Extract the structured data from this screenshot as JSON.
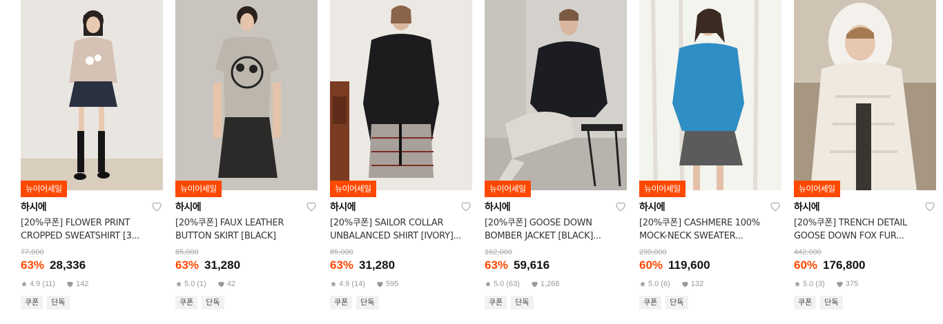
{
  "products": [
    {
      "badge": "뉴이어세일",
      "brand": "하시에",
      "title": "[20%쿠폰] FLOWER PRINT CROPPED SWEATSHIRT [3...",
      "original_price": "77,000",
      "discount": "63%",
      "price": "28,336",
      "rating": "4.9",
      "reviews": "(11)",
      "likes": "142",
      "tags": [
        "쿠폰",
        "단독"
      ],
      "image": "model-flower-sweatshirt-photo"
    },
    {
      "badge": "뉴이어세일",
      "brand": "하시에",
      "title": "[20%쿠폰] FAUX LEATHER BUTTON SKIRT [BLACK]",
      "original_price": "85,000",
      "discount": "63%",
      "price": "31,280",
      "rating": "5.0",
      "reviews": "(1)",
      "likes": "42",
      "tags": [
        "쿠폰",
        "단독"
      ],
      "image": "model-leather-skirt-photo"
    },
    {
      "badge": "뉴이어세일",
      "brand": "하시에",
      "title": "[20%쿠폰] SAILOR COLLAR UNBALANCED SHIRT [IVORY]...",
      "original_price": "85,000",
      "discount": "63%",
      "price": "31,280",
      "rating": "4.9",
      "reviews": "(14)",
      "likes": "595",
      "tags": [
        "쿠폰",
        "단독"
      ],
      "image": "model-sailor-shirt-photo"
    },
    {
      "badge": "뉴이어세일",
      "brand": "하시에",
      "title": "[20%쿠폰] GOOSE DOWN BOMBER JACKET [BLACK]...",
      "original_price": "162,000",
      "discount": "63%",
      "price": "59,616",
      "rating": "5.0",
      "reviews": "(63)",
      "likes": "1,268",
      "tags": [
        "쿠폰",
        "단독"
      ],
      "image": "model-bomber-jacket-photo"
    },
    {
      "badge": "뉴이어세일",
      "brand": "하시에",
      "title": "[20%쿠폰] CASHMERE 100% MOCK-NECK SWEATER...",
      "original_price": "299,000",
      "discount": "60%",
      "price": "119,600",
      "rating": "5.0",
      "reviews": "(6)",
      "likes": "132",
      "tags": [
        "쿠폰",
        "단독"
      ],
      "image": "model-cashmere-sweater-photo"
    },
    {
      "badge": "뉴이어세일",
      "brand": "하시에",
      "title": "[20%쿠폰] TRENCH DETAIL GOOSE DOWN FOX FUR...",
      "original_price": "442,000",
      "discount": "60%",
      "price": "176,800",
      "rating": "5.0",
      "reviews": "(3)",
      "likes": "375",
      "tags": [
        "쿠폰",
        "단독"
      ],
      "image": "model-down-coat-photo"
    }
  ],
  "colors": {
    "accent": "#ff4800",
    "text": "#111111",
    "muted": "#999999"
  }
}
